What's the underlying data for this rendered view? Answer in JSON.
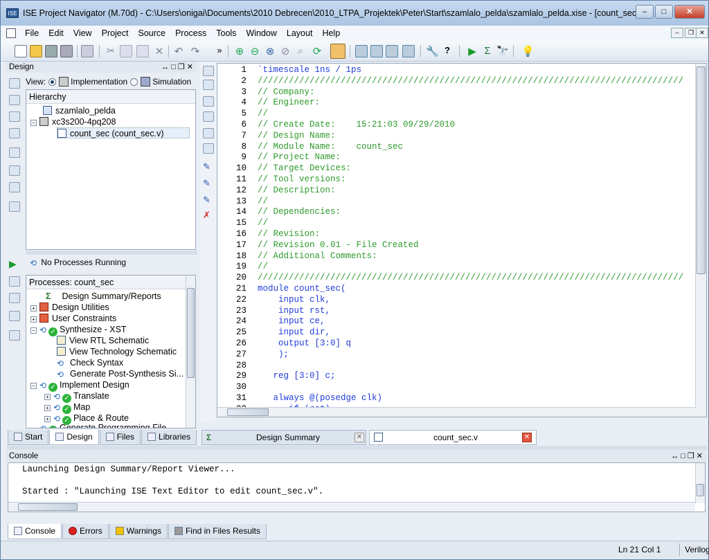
{
  "window": {
    "title": "ISE Project Navigator (M.70d) - C:\\Users\\onigai\\Documents\\2010 Debrecen\\2010_LTPA_Projektek\\Peter\\Start\\szamlalo_pelda\\szamlalo_pelda.xise - [count_sec.v]",
    "app_icon_text": "ISE",
    "min": "–",
    "max": "□",
    "close": "✕"
  },
  "menu": [
    "File",
    "Edit",
    "View",
    "Project",
    "Source",
    "Process",
    "Tools",
    "Window",
    "Layout",
    "Help"
  ],
  "design_panel": {
    "title": "Design",
    "controls": "↔□❐✕",
    "view_label": "View:",
    "impl_label": "Implementation",
    "sim_label": "Simulation",
    "hierarchy_header": "Hierarchy",
    "tree": [
      {
        "label": "szamlalo_pelda",
        "indent": 0
      },
      {
        "label": "xc3s200-4pq208",
        "indent": 0
      },
      {
        "label": "count_sec (count_sec.v)",
        "indent": 1
      }
    ]
  },
  "process_panel": {
    "status": "No Processes Running",
    "header": "Processes: count_sec",
    "items": [
      {
        "label": "Design Summary/Reports"
      },
      {
        "label": "Design Utilities"
      },
      {
        "label": "User Constraints"
      },
      {
        "label": "Synthesize - XST"
      },
      {
        "label": "View RTL Schematic"
      },
      {
        "label": "View Technology Schematic"
      },
      {
        "label": "Check Syntax"
      },
      {
        "label": "Generate Post-Synthesis Si..."
      },
      {
        "label": "Implement Design"
      },
      {
        "label": "Translate"
      },
      {
        "label": "Map"
      },
      {
        "label": "Place & Route"
      },
      {
        "label": "Generate Programming File"
      }
    ]
  },
  "left_tabs": [
    "Start",
    "Design",
    "Files",
    "Libraries"
  ],
  "doc_tabs": [
    {
      "label": "Design Summary"
    },
    {
      "label": "count_sec.v"
    }
  ],
  "code": [
    {
      "n": "1",
      "t": "`timescale 1ns / 1ps",
      "c": "kw"
    },
    {
      "n": "2",
      "t": "//////////////////////////////////////////////////////////////////////////////////",
      "c": "cm"
    },
    {
      "n": "3",
      "t": "// Company:",
      "c": "cm"
    },
    {
      "n": "4",
      "t": "// Engineer:",
      "c": "cm"
    },
    {
      "n": "5",
      "t": "//",
      "c": "cm"
    },
    {
      "n": "6",
      "t": "// Create Date:    15:21:03 09/29/2010",
      "c": "cm"
    },
    {
      "n": "7",
      "t": "// Design Name:",
      "c": "cm"
    },
    {
      "n": "8",
      "t": "// Module Name:    count_sec",
      "c": "cm"
    },
    {
      "n": "9",
      "t": "// Project Name:",
      "c": "cm"
    },
    {
      "n": "10",
      "t": "// Target Devices:",
      "c": "cm"
    },
    {
      "n": "11",
      "t": "// Tool versions:",
      "c": "cm"
    },
    {
      "n": "12",
      "t": "// Description:",
      "c": "cm"
    },
    {
      "n": "13",
      "t": "//",
      "c": "cm"
    },
    {
      "n": "14",
      "t": "// Dependencies:",
      "c": "cm"
    },
    {
      "n": "15",
      "t": "//",
      "c": "cm"
    },
    {
      "n": "16",
      "t": "// Revision:",
      "c": "cm"
    },
    {
      "n": "17",
      "t": "// Revision 0.01 - File Created",
      "c": "cm"
    },
    {
      "n": "18",
      "t": "// Additional Comments:",
      "c": "cm"
    },
    {
      "n": "19",
      "t": "//",
      "c": "cm"
    },
    {
      "n": "20",
      "t": "//////////////////////////////////////////////////////////////////////////////////",
      "c": "cm"
    },
    {
      "n": "21",
      "t": "module count_sec(",
      "c": "kw"
    },
    {
      "n": "22",
      "t": "    input clk,",
      "c": "kw"
    },
    {
      "n": "23",
      "t": "    input rst,",
      "c": "kw"
    },
    {
      "n": "24",
      "t": "    input ce,",
      "c": "kw"
    },
    {
      "n": "25",
      "t": "    input dir,",
      "c": "kw"
    },
    {
      "n": "26",
      "t": "    output [3:0] q",
      "c": "kw"
    },
    {
      "n": "27",
      "t": "    );",
      "c": "kw"
    },
    {
      "n": "28",
      "t": "",
      "c": ""
    },
    {
      "n": "29",
      "t": "   reg [3:0] c;",
      "c": "kw"
    },
    {
      "n": "30",
      "t": "",
      "c": ""
    },
    {
      "n": "31",
      "t": "   always @(posedge clk)",
      "c": "kw"
    },
    {
      "n": "32",
      "t": "      if (rst)",
      "c": "kw"
    }
  ],
  "console": {
    "title": "Console",
    "controls": "↔□❐✕",
    "lines": [
      "Launching Design Summary/Report Viewer...",
      "",
      "Started : \"Launching ISE Text Editor to edit count_sec.v\"."
    ]
  },
  "console_tabs": [
    "Console",
    "Errors",
    "Warnings",
    "Find in Files Results"
  ],
  "status": {
    "position": "Ln 21 Col 1",
    "language": "Verilog"
  }
}
